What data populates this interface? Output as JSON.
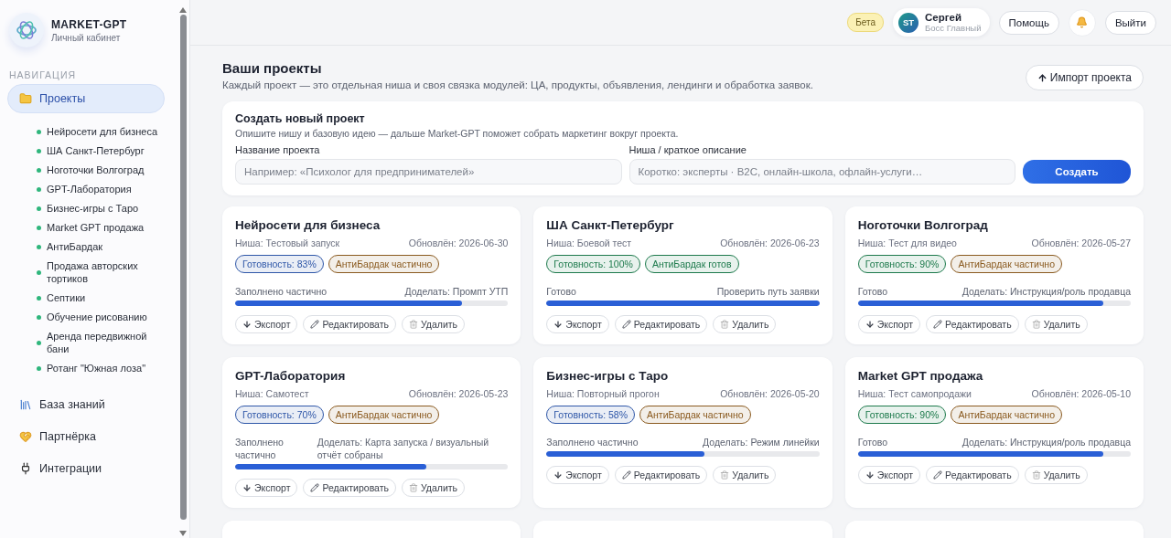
{
  "brand": {
    "name": "MARKET-GPT",
    "subtitle": "Личный кабинет"
  },
  "sidebar": {
    "section_title": "НАВИГАЦИЯ",
    "items": [
      {
        "kind": "folder",
        "label": "Проекты",
        "selected": true,
        "children": [
          {
            "label": "Нейросети для бизнеса",
            "color": "#2fb67c"
          },
          {
            "label": "ША Санкт-Петербург",
            "color": "#2fb67c"
          },
          {
            "label": "Ноготочки Волгоград",
            "color": "#2fb67c"
          },
          {
            "label": "GPT-Лаборатория",
            "color": "#2fb67c"
          },
          {
            "label": "Бизнес-игры с Таро",
            "color": "#2fb67c"
          },
          {
            "label": "Market GPT продажа",
            "color": "#2fb67c"
          },
          {
            "label": "АнтиБардак",
            "color": "#2fb67c"
          },
          {
            "label": "Продажа авторских тортиков",
            "color": "#2fb67c"
          },
          {
            "label": "Септики",
            "color": "#2fb67c"
          },
          {
            "label": "Обучение рисованию",
            "color": "#2fb67c"
          },
          {
            "label": "Аренда передвижной бани",
            "color": "#2fb67c"
          },
          {
            "label": "Ротанг \"Южная лоза\"",
            "color": "#2fb67c"
          }
        ]
      },
      {
        "kind": "books",
        "label": "База знаний",
        "selected": false
      },
      {
        "kind": "heart",
        "label": "Партнёрка",
        "selected": false
      },
      {
        "kind": "plug",
        "label": "Интеграции",
        "selected": false
      }
    ]
  },
  "header": {
    "badge": "Бета",
    "user": {
      "initials": "ST",
      "name": "Сергей",
      "role": "Босс Главный"
    },
    "help": "Помощь",
    "logout": "Выйти"
  },
  "page": {
    "title": "Ваши проекты",
    "subtitle": "Каждый проект — это отдельная ниша и своя связка модулей: ЦА, продукты, объявления, лендинги и обработка заявок.",
    "import_button": "Импорт проекта"
  },
  "create": {
    "title": "Создать новый проект",
    "hint": "Опишите нишу и базовую идею — дальше Market-GPT поможет собрать маркетинг вокруг проекта.",
    "name_label": "Название проекта",
    "name_placeholder": "Например: «Психолог для предпринимателей»",
    "niche_label": "Ниша / краткое описание",
    "niche_placeholder": "Коротко: эксперты · B2C, онлайн-школа, офлайн-услуги…",
    "button": "Создать"
  },
  "projects": [
    {
      "title": "Нейросети для бизнеса",
      "niche": "Ниша: Тестовый запуск",
      "updated": "Обновлён: 2026-06-30",
      "tags": [
        {
          "label": "Готовность: 83%",
          "color": "#2f57a8"
        },
        {
          "label": "АнтиБардак частично",
          "color": "#8a5a1f"
        }
      ],
      "status": "Заполнено частично",
      "todo": "Доделать: Промпт УТП",
      "level": 0.83,
      "actions": [
        {
          "kind": "export",
          "label": "Экспорт"
        },
        {
          "kind": "edit",
          "label": "Редактировать"
        },
        {
          "kind": "delete",
          "label": "Удалить"
        }
      ]
    },
    {
      "title": "ША Санкт-Петербург",
      "niche": "Ниша: Боевой тест",
      "updated": "Обновлён: 2026-06-23",
      "tags": [
        {
          "label": "Готовность: 100%",
          "color": "#1d7a4c"
        },
        {
          "label": "АнтиБардак готов",
          "color": "#1d7a4c"
        }
      ],
      "status": "Готово",
      "todo": "Проверить путь заявки",
      "level": 1,
      "actions": [
        {
          "kind": "export",
          "label": "Экспорт"
        },
        {
          "kind": "edit",
          "label": "Редактировать"
        },
        {
          "kind": "delete",
          "label": "Удалить"
        }
      ]
    },
    {
      "title": "Ноготочки Волгоград",
      "niche": "Ниша: Тест для видео",
      "updated": "Обновлён: 2026-05-27",
      "tags": [
        {
          "label": "Готовность: 90%",
          "color": "#1d7a4c"
        },
        {
          "label": "АнтиБардак частично",
          "color": "#8a5a1f"
        }
      ],
      "status": "Готово",
      "todo": "Доделать: Инструкция/роль продавца",
      "level": 0.9,
      "actions": [
        {
          "kind": "export",
          "label": "Экспорт"
        },
        {
          "kind": "edit",
          "label": "Редактировать"
        },
        {
          "kind": "delete",
          "label": "Удалить"
        }
      ]
    },
    {
      "title": "GPT-Лаборатория",
      "niche": "Ниша: Самотест",
      "updated": "Обновлён: 2026-05-23",
      "tags": [
        {
          "label": "Готовность: 70%",
          "color": "#2f57a8"
        },
        {
          "label": "АнтиБардак частично",
          "color": "#8a5a1f"
        }
      ],
      "status": "Заполнено частично",
      "todo": "Доделать: Карта запуска / визуальный отчёт собраны",
      "level": 0.7,
      "actions": [
        {
          "kind": "export",
          "label": "Экспорт"
        },
        {
          "kind": "edit",
          "label": "Редактировать"
        },
        {
          "kind": "delete",
          "label": "Удалить"
        }
      ]
    },
    {
      "title": "Бизнес-игры с Таро",
      "niche": "Ниша: Повторный прогон",
      "updated": "Обновлён: 2026-05-20",
      "tags": [
        {
          "label": "Готовность: 58%",
          "color": "#2f57a8"
        },
        {
          "label": "АнтиБардак частично",
          "color": "#8a5a1f"
        }
      ],
      "status": "Заполнено частично",
      "todo": "Доделать: Режим линейки",
      "level": 0.58,
      "actions": [
        {
          "kind": "export",
          "label": "Экспорт"
        },
        {
          "kind": "edit",
          "label": "Редактировать"
        },
        {
          "kind": "delete",
          "label": "Удалить"
        }
      ]
    },
    {
      "title": "Market GPT продажа",
      "niche": "Ниша: Тест самопродажи",
      "updated": "Обновлён: 2026-05-10",
      "tags": [
        {
          "label": "Готовность: 90%",
          "color": "#1d7a4c"
        },
        {
          "label": "АнтиБардак частично",
          "color": "#8a5a1f"
        }
      ],
      "status": "Готово",
      "todo": "Доделать: Инструкция/роль продавца",
      "level": 0.9,
      "actions": [
        {
          "kind": "export",
          "label": "Экспорт"
        },
        {
          "kind": "edit",
          "label": "Редактировать"
        },
        {
          "kind": "delete",
          "label": "Удалить"
        }
      ]
    }
  ]
}
